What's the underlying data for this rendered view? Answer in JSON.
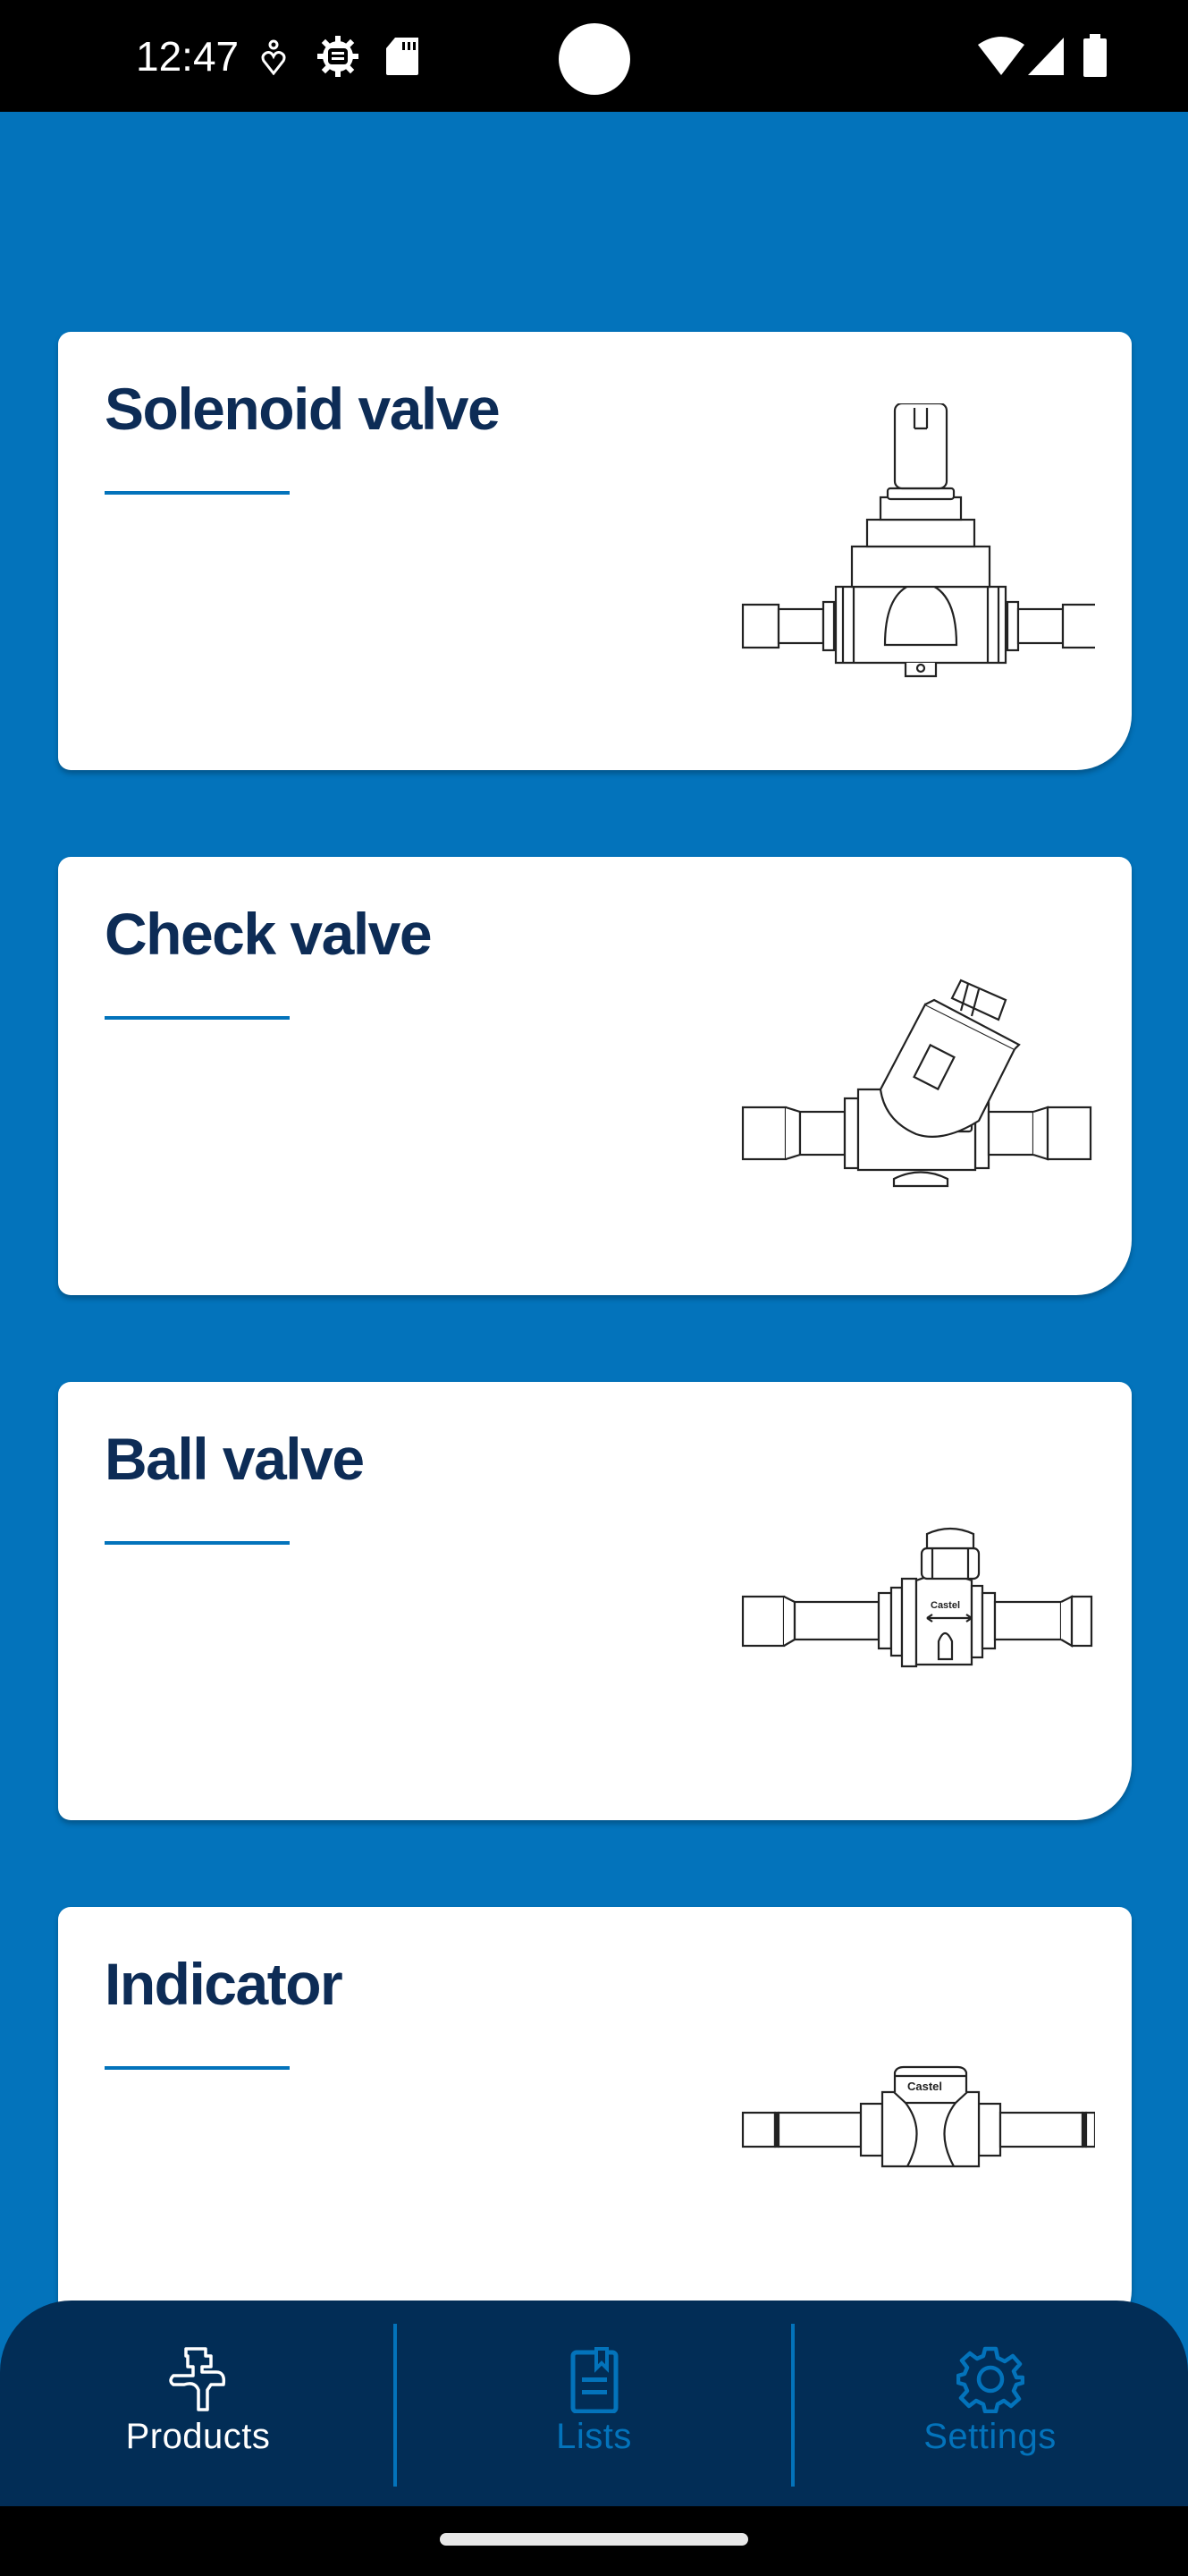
{
  "status_bar": {
    "time": "12:47",
    "left_icons": [
      "accessibility-heart-icon",
      "gear-settings-icon",
      "sd-card-icon"
    ],
    "right_icons": [
      "wifi-icon",
      "cellular-signal-icon",
      "battery-icon"
    ]
  },
  "products": [
    {
      "title": "Solenoid valve",
      "image": "solenoid-valve-drawing"
    },
    {
      "title": "Check valve",
      "image": "check-valve-drawing"
    },
    {
      "title": "Ball valve",
      "image": "ball-valve-drawing"
    },
    {
      "title": "Indicator",
      "image": "indicator-drawing"
    }
  ],
  "nav": {
    "items": [
      {
        "label": "Products",
        "icon": "valve-icon",
        "active": true
      },
      {
        "label": "Lists",
        "icon": "clipboard-list-icon",
        "active": false
      },
      {
        "label": "Settings",
        "icon": "gear-icon",
        "active": false
      }
    ],
    "active_color": "#ffffff",
    "inactive_color": "#0373bb"
  },
  "colors": {
    "background": "#0373bb",
    "title": "#0d2c56",
    "nav_background": "#022d56"
  }
}
